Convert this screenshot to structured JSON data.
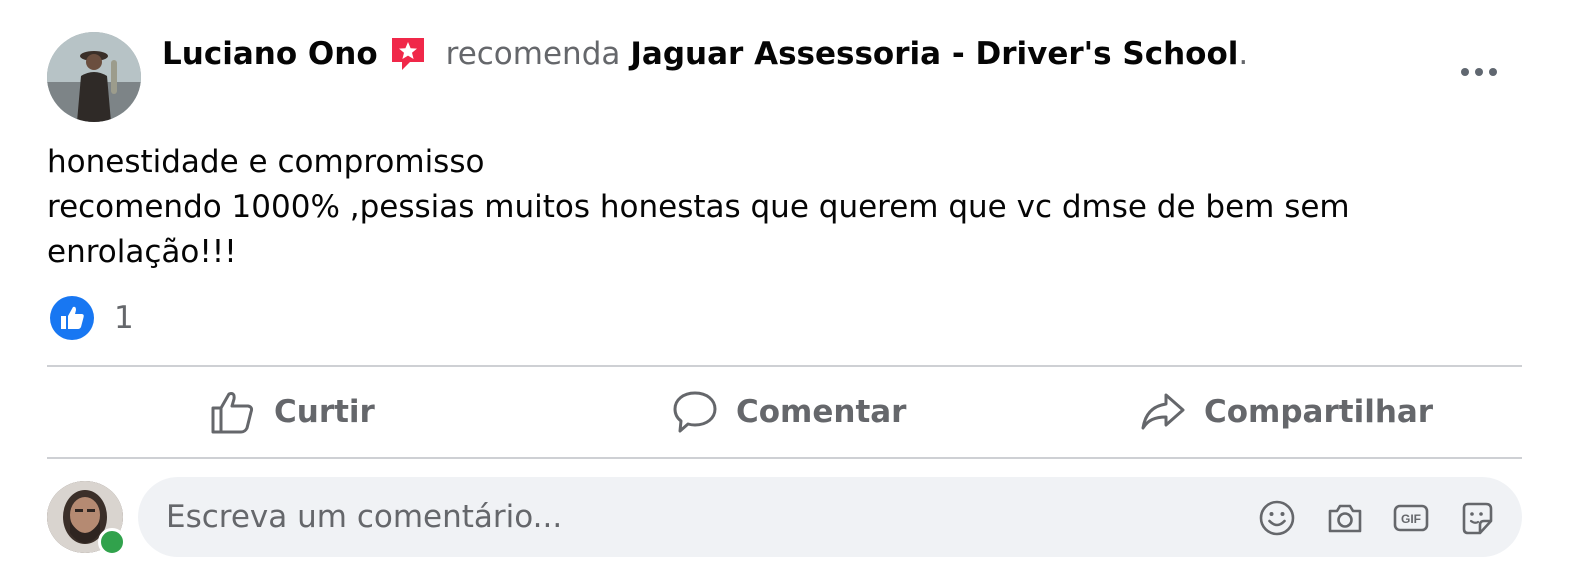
{
  "post": {
    "author": "Luciano Ono",
    "verb": "recomenda",
    "page_name": "Jaguar Assessoria - Driver's School",
    "trailing": ".",
    "body_lines": [
      "honestidade e compromisso",
      "recomendo 1000% ,pessias muitos honestas que querem que vc dmse de bem sem enrolação!!!"
    ],
    "reaction_count": "1",
    "reaction_icon": "like-reaction-icon"
  },
  "actions": {
    "like": "Curtir",
    "comment": "Comentar",
    "share": "Compartilhar"
  },
  "comment_box": {
    "placeholder": "Escreva um comentário...",
    "icons": [
      "emoji-icon",
      "camera-icon",
      "gif-icon",
      "sticker-icon"
    ]
  },
  "colors": {
    "like_blue": "#1877f2",
    "recommend_red": "#f02849",
    "secondary_text": "#65676b",
    "online_green": "#31a24c"
  }
}
